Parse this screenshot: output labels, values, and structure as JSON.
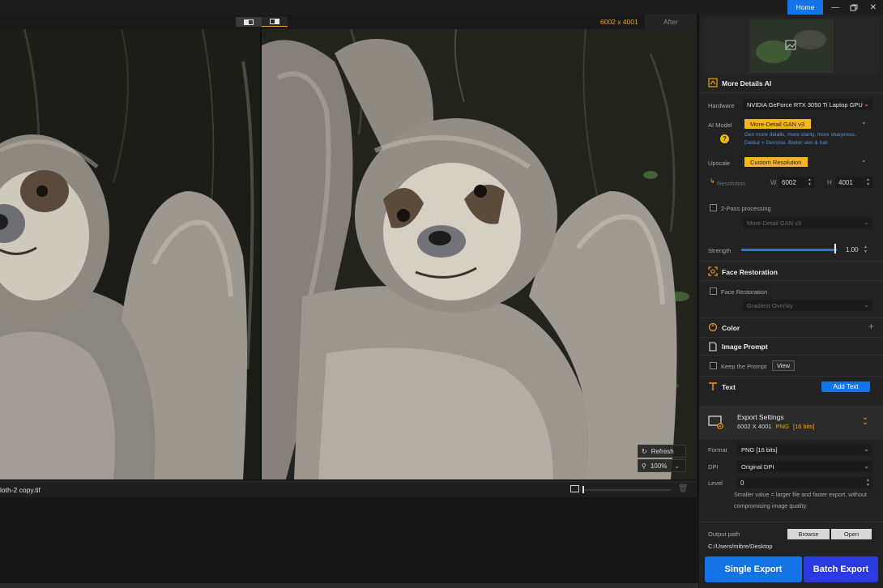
{
  "titlebar": {
    "home_label": "Home",
    "minimize_icon": "minimize-icon",
    "maximize_icon": "restore-icon",
    "close_icon": "close-icon",
    "accent_color": "#1473e6"
  },
  "viewer": {
    "resolution": "6002 x 4001",
    "after_label": "After",
    "refresh_label": "Refresh",
    "zoom_value": "100%",
    "filename": "loth-2 copy.tif"
  },
  "panel": {
    "more_details": {
      "title": "More Details AI",
      "hardware_label": "Hardware",
      "hardware_value": "NVIDIA GeForce RTX 3050 Ti Laptop GPU",
      "ai_model_label": "AI Model",
      "ai_model_value": "More-Detail GAN  v3",
      "ai_model_hint_1": "Gen more details, more clarity, more sharpness,",
      "ai_model_hint_2": "Deblur + Denoise. Better skin & hair",
      "upscale_label": "Upscale",
      "upscale_value": "Custom Resolution",
      "resolution_label": "Resolution",
      "w_label": "W",
      "w_value": "6002",
      "h_label": "H",
      "h_value": "4001",
      "two_pass_label": "2-Pass processing",
      "two_pass_model": "More-Detail GAN  v3",
      "strength_label": "Strength",
      "strength_value": "1.00",
      "strength_level": 1.0
    },
    "face": {
      "title": "Face Restoration",
      "checkbox_label": "Face Restoration",
      "overlay_value": "Gradient Overlay"
    },
    "color": {
      "title": "Color",
      "add_symbol": "+"
    },
    "prompt": {
      "title": "Image Prompt",
      "keep_label": "Keep the Prompt",
      "view_label": "View"
    },
    "text": {
      "title": "Text",
      "add_label": "Add Text"
    },
    "export": {
      "title": "Export Settings",
      "summary_size": "6002 X 4001",
      "summary_format": "PNG",
      "summary_bits": "[16 bits]",
      "format_label": "Format",
      "format_value": "PNG   [16 bits]",
      "dpi_label": "DPI",
      "dpi_value": "Original DPI",
      "level_label": "Level",
      "level_value": "0",
      "note_1": "Smaller value = larger file and faster export, without",
      "note_2": "compromising image quality.",
      "output_label": "Output path",
      "browse_label": "Browse",
      "open_label": "Open",
      "output_path": "C:/Users/mibre/Desktop",
      "single_label": "Single Export",
      "batch_label": "Batch Export"
    }
  }
}
